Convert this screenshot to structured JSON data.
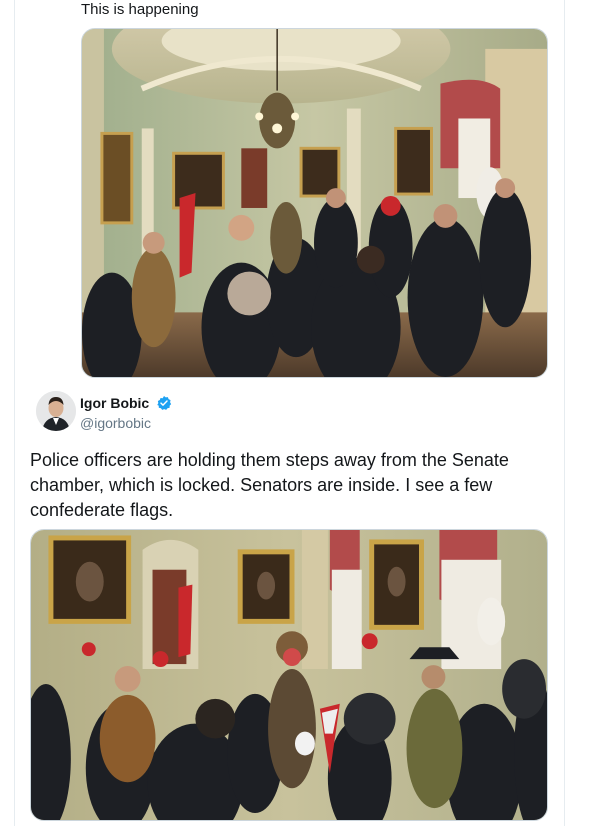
{
  "quoted_tweet": {
    "text": "This is happening"
  },
  "author": {
    "display_name": "Igor Bobic",
    "handle": "@igorbobic",
    "verified": true,
    "verified_icon": "verified-badge-icon"
  },
  "tweet": {
    "text": "Police officers are holding them steps away from the Senate chamber, which is locked. Senators are inside. I see a few confederate flags."
  },
  "colors": {
    "verified_blue": "#1da1f2",
    "handle_gray": "#657786",
    "text": "#14171a",
    "border": "#ccd6dd"
  }
}
